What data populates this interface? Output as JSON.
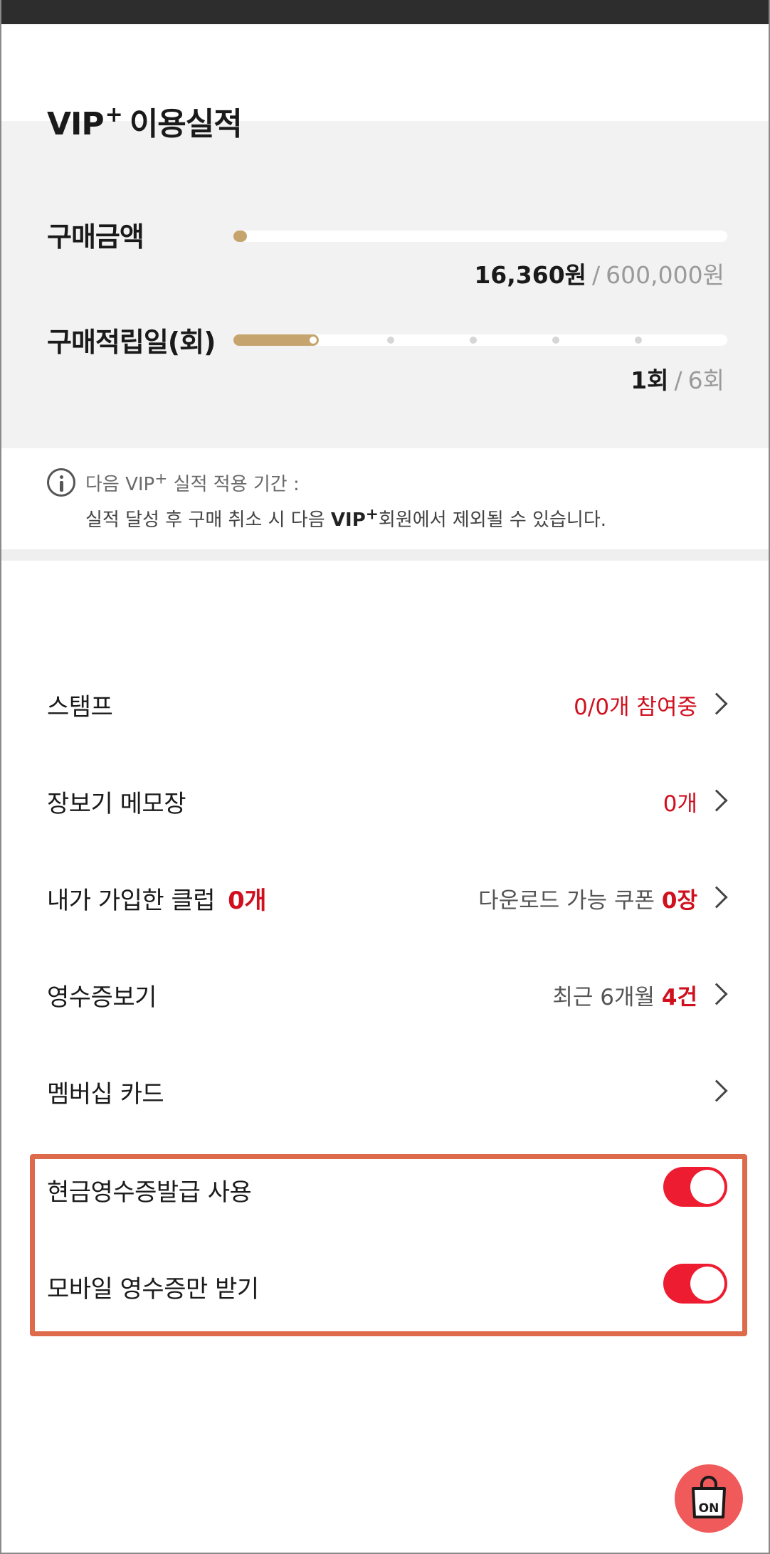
{
  "performance": {
    "title_main": "VIP",
    "title_sup": "+",
    "title_rest": "이용실적",
    "purchase_amount": {
      "label": "구매금액",
      "current": "16,360원",
      "target": "600,000원",
      "progress": 0.027
    },
    "purchase_days": {
      "label": "구매적립일(회)",
      "current": "1회",
      "target": "6회",
      "progress": 0.167
    },
    "progress_color": "#c6a46e"
  },
  "info": {
    "line1_pre": "다음 VIP",
    "line1_sup": "+",
    "line1_post": " 실적 적용 기간 :",
    "line2_pre": "실적 달성 후 구매 취소 시 다음 ",
    "line2_bold": "VIP",
    "line2_sup": "+",
    "line2_post": "회원에서 제외될 수 있습니다."
  },
  "menu": {
    "stamp": {
      "label": "스탬프",
      "value": "0/0개 참여중"
    },
    "memo": {
      "label": "장보기 메모장",
      "value": "0개"
    },
    "club": {
      "label": "내가 가입한 클럽",
      "count": "0개",
      "coupon_label": "다운로드 가능 쿠폰 ",
      "coupon_count": "0장"
    },
    "receipt": {
      "label": "영수증보기",
      "period": "최근 6개월 ",
      "count": "4건"
    },
    "membership": {
      "label": "멤버십 카드"
    }
  },
  "toggles": {
    "cash_receipt": {
      "label": "현금영수증발급 사용",
      "on": true
    },
    "mobile_receipt": {
      "label": "모바일 영수증만 받기",
      "on": true
    }
  },
  "fab": {
    "label": "ON",
    "icon": "shopping-bag-icon",
    "color": "#f05a5a"
  },
  "colors": {
    "accent_red": "#d0101f",
    "toggle_on": "#ee1c30",
    "highlight_border": "#dd6a4a"
  }
}
